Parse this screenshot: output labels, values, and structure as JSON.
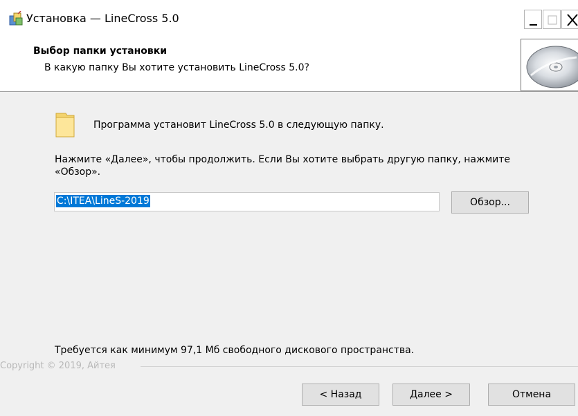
{
  "window": {
    "title": "Установка — LineCross 5.0",
    "minimize_glyph": "_",
    "maximize_glyph": "□",
    "close_glyph": "X"
  },
  "header": {
    "title": "Выбор папки установки",
    "subtitle": "В какую папку Вы хотите установить LineCross 5.0?",
    "image_icon": "cd-disc-icon"
  },
  "content": {
    "folder_icon": "folder-icon",
    "info_text": "Программа установит LineCross 5.0 в следующую папку.",
    "instructions": "Нажмите «Далее», чтобы продолжить. Если Вы хотите выбрать другую папку, нажмите «Обзор».",
    "path_value": "C:\\ITEA\\LineS-2019",
    "browse_label": "Обзор...",
    "disk_requirement": "Требуется как минимум 97,1 Мб свободного дискового пространства."
  },
  "footer": {
    "copyright": "Copyright © 2019, Айтея",
    "back_label": "< Назад",
    "next_label": "Далее >",
    "cancel_label": "Отмена"
  },
  "colors": {
    "selection": "#0078d7",
    "button_face": "#e1e1e1",
    "dialog_bg": "#f0f0f0"
  }
}
